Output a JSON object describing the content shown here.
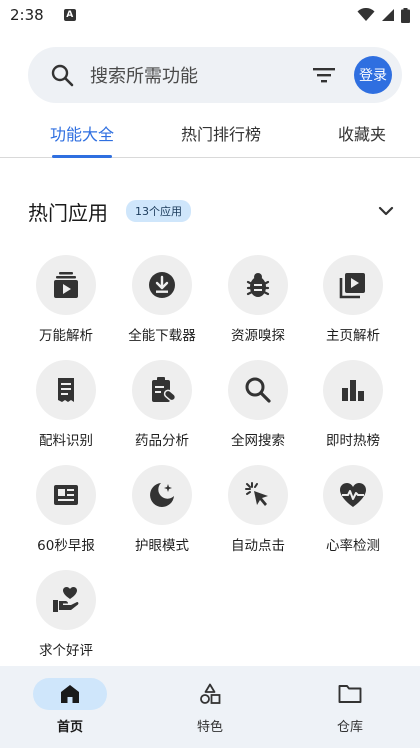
{
  "status_bar": {
    "time": "2:38",
    "notification_letter": "A"
  },
  "search": {
    "placeholder": "搜索所需功能",
    "login_label": "登录"
  },
  "tabs": [
    {
      "label": "功能大全",
      "active": true
    },
    {
      "label": "热门排行榜",
      "active": false
    },
    {
      "label": "收藏夹",
      "active": false
    }
  ],
  "section": {
    "title": "热门应用",
    "badge": "13个应用"
  },
  "apps": [
    {
      "label": "万能解析",
      "icon": "layers-play-icon"
    },
    {
      "label": "全能下载器",
      "icon": "download-circle-icon"
    },
    {
      "label": "资源嗅探",
      "icon": "bug-icon"
    },
    {
      "label": "主页解析",
      "icon": "video-library-icon"
    },
    {
      "label": "配料识别",
      "icon": "receipt-icon"
    },
    {
      "label": "药品分析",
      "icon": "clipboard-pill-icon"
    },
    {
      "label": "全网搜索",
      "icon": "search-icon"
    },
    {
      "label": "即时热榜",
      "icon": "bar-chart-icon"
    },
    {
      "label": "60秒早报",
      "icon": "newspaper-icon"
    },
    {
      "label": "护眼模式",
      "icon": "moon-stars-icon"
    },
    {
      "label": "自动点击",
      "icon": "cursor-click-icon"
    },
    {
      "label": "心率检测",
      "icon": "heart-pulse-icon"
    },
    {
      "label": "求个好评",
      "icon": "hand-heart-icon"
    }
  ],
  "bottom_nav": [
    {
      "label": "首页",
      "icon": "home-icon",
      "active": true
    },
    {
      "label": "特色",
      "icon": "shapes-icon",
      "active": false
    },
    {
      "label": "仓库",
      "icon": "folder-icon",
      "active": false
    }
  ],
  "colors": {
    "accent": "#2f6fe0",
    "badge_bg": "#cfe6fb",
    "icon_bg": "#eeeeee",
    "search_bg": "#eef1f5"
  }
}
